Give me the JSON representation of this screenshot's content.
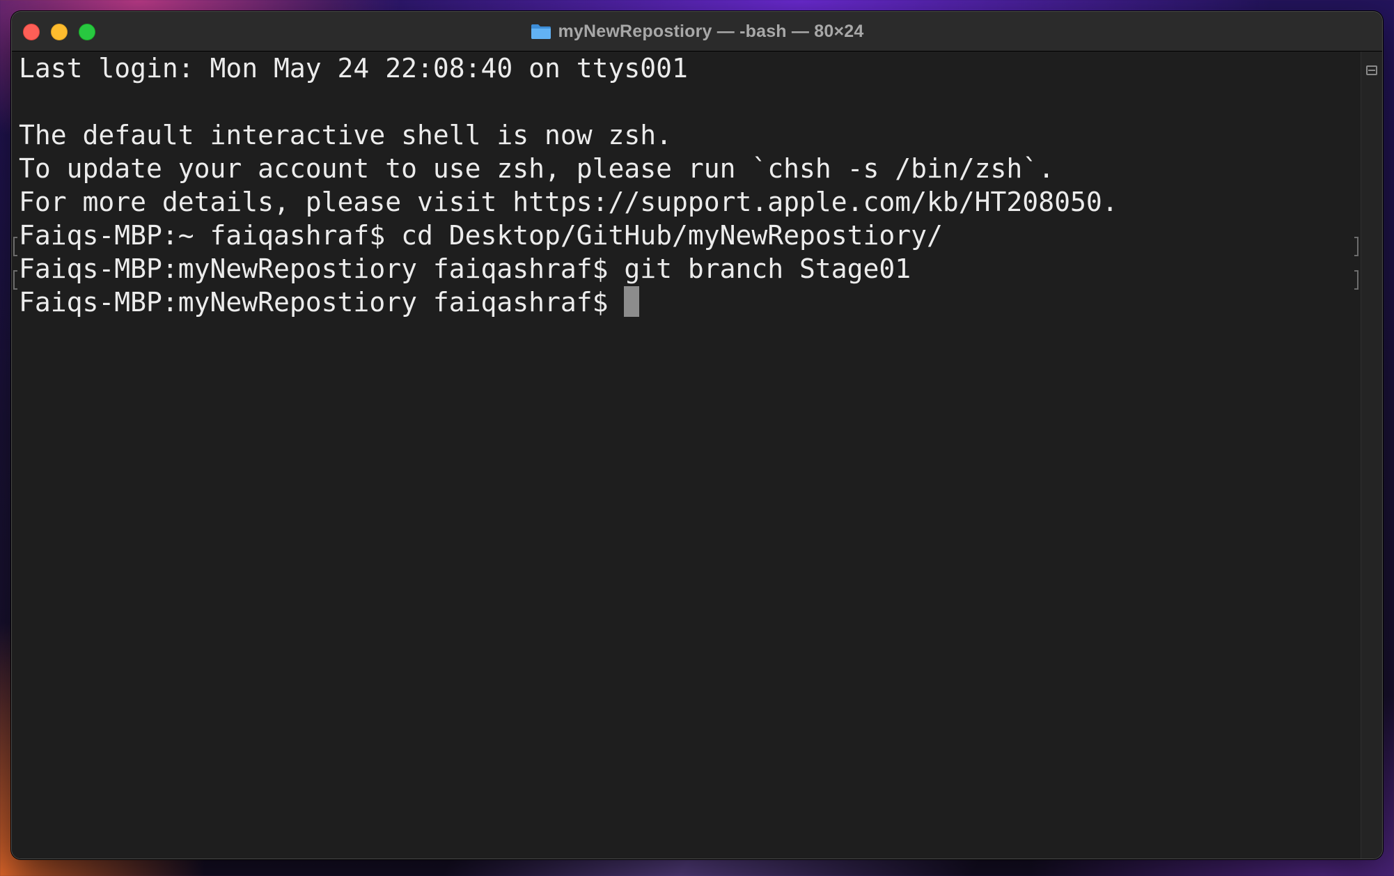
{
  "window": {
    "title": "myNewRepostiory — -bash — 80×24",
    "folder_icon": "folder-icon",
    "folder_color": "#54a8f0"
  },
  "terminal": {
    "background": "#1e1e1e",
    "foreground": "#ececec",
    "lines": [
      "Last login: Mon May 24 22:08:40 on ttys001",
      "",
      "The default interactive shell is now zsh.",
      "To update your account to use zsh, please run `chsh -s /bin/zsh`.",
      "For more details, please visit https://support.apple.com/kb/HT208050.",
      "Faiqs-MBP:~ faiqashraf$ cd Desktop/GitHub/myNewRepostiory/",
      "Faiqs-MBP:myNewRepostiory faiqashraf$ git branch Stage01",
      "Faiqs-MBP:myNewRepostiory faiqashraf$ "
    ],
    "cursor_icon": "block-cursor"
  }
}
